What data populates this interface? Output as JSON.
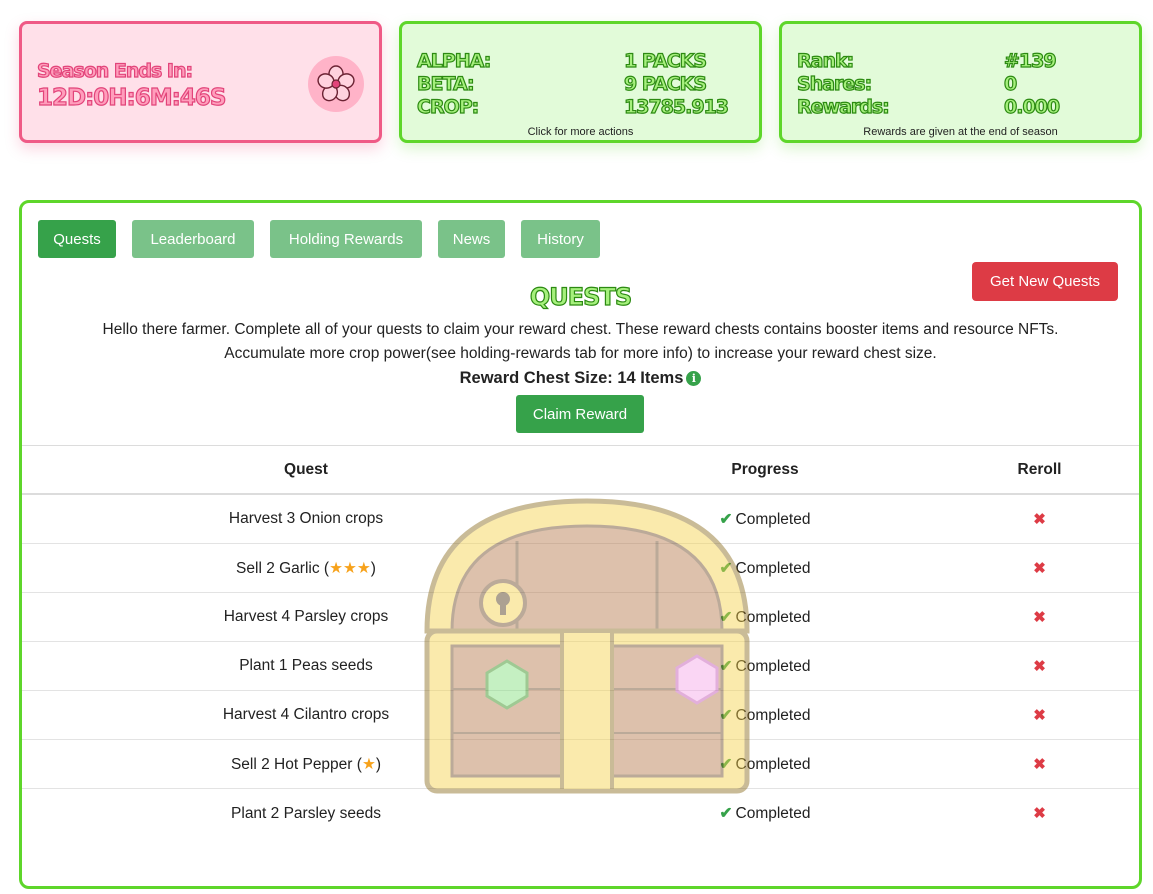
{
  "season": {
    "label": "Season Ends In:",
    "countdown": "12D:0H:6M:46S"
  },
  "wallet": {
    "rows": [
      {
        "label": "ALPHA:",
        "value": "1 PACKS"
      },
      {
        "label": "BETA:",
        "value": "9 PACKS"
      },
      {
        "label": "CROP:",
        "value": "13785.913"
      }
    ],
    "note": "Click for more actions"
  },
  "stats": {
    "rows": [
      {
        "label": "Rank:",
        "value": "#139"
      },
      {
        "label": "Shares:",
        "value": "0"
      },
      {
        "label": "Rewards:",
        "value": "0.000"
      }
    ],
    "note": "Rewards are given at the end of season"
  },
  "tabs": [
    {
      "label": "Quests",
      "active": true
    },
    {
      "label": "Leaderboard",
      "active": false
    },
    {
      "label": "Holding Rewards",
      "active": false
    },
    {
      "label": "News",
      "active": false
    },
    {
      "label": "History",
      "active": false
    }
  ],
  "quests": {
    "title": "QUESTS",
    "intro_line1": "Hello there farmer. Complete all of your quests to claim your reward chest. These reward chests contains booster items and resource NFTs.",
    "intro_line2": "Accumulate more crop power(see holding-rewards tab for more info) to increase your reward chest size.",
    "chest_size": "Reward Chest Size: 14 Items",
    "get_new_label": "Get New Quests",
    "claim_label": "Claim Reward",
    "columns": [
      "Quest",
      "Progress",
      "Reroll"
    ],
    "rows": [
      {
        "quest": "Harvest 3 Onion crops",
        "stars": "",
        "progress": "Completed"
      },
      {
        "quest": "Sell 2 Garlic",
        "stars": "★★★",
        "progress": "Completed"
      },
      {
        "quest": "Harvest 4 Parsley crops",
        "stars": "",
        "progress": "Completed"
      },
      {
        "quest": "Plant 1 Peas seeds",
        "stars": "",
        "progress": "Completed"
      },
      {
        "quest": "Harvest 4 Cilantro crops",
        "stars": "",
        "progress": "Completed"
      },
      {
        "quest": "Sell 2 Hot Pepper",
        "stars": "★",
        "progress": "Completed"
      },
      {
        "quest": "Plant 2 Parsley seeds",
        "stars": "",
        "progress": "Completed"
      }
    ]
  },
  "colors": {
    "pink_border": "#ef5a86",
    "green_border": "#5ed62a",
    "primary_green": "#36a24a",
    "danger_red": "#dd3b45"
  },
  "icons": {
    "season_badge": "flower-icon",
    "info": "info-icon",
    "completed": "check-icon",
    "reroll": "x-icon"
  }
}
